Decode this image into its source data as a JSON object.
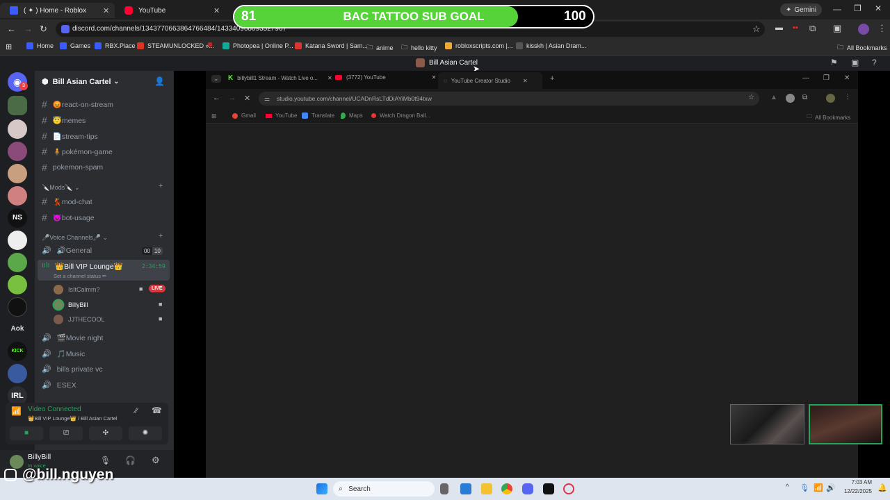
{
  "outer_browser": {
    "tabs": [
      {
        "label": "( ✦ ) Home - Roblox",
        "icon": "roblox-icon",
        "color": "#3a5cff"
      },
      {
        "label": "YouTube",
        "icon": "youtube-icon",
        "color": "#ff0033"
      }
    ],
    "gemini_label": "Gemini",
    "url": "discord.com/channels/1343770663864766484/143340968093527967",
    "bookmarks": [
      {
        "label": "Home",
        "icon": "roblox-icon",
        "color": "#3a5cff"
      },
      {
        "label": "Games",
        "icon": "roblox-icon",
        "color": "#3a5cff"
      },
      {
        "label": "RBX.Place",
        "icon": "rbx-icon",
        "color": "#3a5cff"
      },
      {
        "label": "STEAMUNLOCKED »...",
        "icon": "steam-icon",
        "color": "#d32"
      },
      {
        "label": "",
        "icon": "red-icon",
        "color": "#c22"
      },
      {
        "label": "Photopea | Online P...",
        "icon": "photopea-icon",
        "color": "#1a9"
      },
      {
        "label": "Katana Sword | Sam...",
        "icon": "katana-icon",
        "color": "#d33"
      },
      {
        "label": "anime",
        "icon": "folder-icon",
        "color": "#aaa"
      },
      {
        "label": "hello kitty",
        "icon": "folder-icon",
        "color": "#aaa"
      },
      {
        "label": "robloxscripts.com |...",
        "icon": "roblox-scripts-icon",
        "color": "#ea3"
      },
      {
        "label": "kisskh | Asian Dram...",
        "icon": "kisskh-icon",
        "color": "#555"
      }
    ],
    "all_bookmarks": "All Bookmarks"
  },
  "goal": {
    "start": "81",
    "title": "BAC TATTOO SUB GOAL",
    "end": "100",
    "fill_fraction": 0.79,
    "fill_color": "#57d33a"
  },
  "discord": {
    "title": "Bill Asian Cartel",
    "server_name": "Bill Asian Cartel",
    "channels": [
      {
        "name": "😡react-on-stream"
      },
      {
        "name": "😇memes"
      },
      {
        "name": "📄stream-tips"
      },
      {
        "name": "🧍pokémon-game"
      },
      {
        "name": "pokemon-spam"
      }
    ],
    "mods_category": "🔪Mods🔪",
    "mod_channels": [
      {
        "name": "💃mod-chat"
      },
      {
        "name": "😈bot-usage"
      }
    ],
    "voice_category": "🎤Voice Channels🎤",
    "voice_general": "🔊General",
    "voice_general_counts": [
      "00",
      "10"
    ],
    "vip_lounge": "👑Bill VIP Lounge👑",
    "vip_timer": "2:34:59",
    "channel_status": "Set a channel status ✏",
    "voice_users": [
      {
        "name": "IsItCalmm?",
        "live": "LIVE"
      },
      {
        "name": "BillyBill",
        "live": ""
      },
      {
        "name": "JJTHECOOL",
        "live": ""
      }
    ],
    "more_voice": [
      {
        "name": "🎬Movie night"
      },
      {
        "name": "🎵Music"
      },
      {
        "name": "bills private vc"
      },
      {
        "name": "ESEX"
      }
    ],
    "connection_status": "Video Connected",
    "connection_channel": "👑Bill VIP Lounge👑 / Bill Asian Cartel",
    "user_name": "BillyBill",
    "user_status": "In voice",
    "server_abbrs": [
      "NS",
      "Aok",
      "IRL"
    ]
  },
  "inner_browser": {
    "tabs": [
      {
        "label": "billybill1 Stream - Watch Live o...",
        "icon": "kick-icon",
        "color": "#53fc18"
      },
      {
        "label": "(3772) YouTube",
        "icon": "youtube-icon",
        "color": "#ff0033"
      },
      {
        "label": "YouTube Creator Studio",
        "icon": "loading-icon",
        "color": "#888"
      }
    ],
    "url": "studio.youtube.com/channel/UCADnRsLTdDiAYiMb0t94txw",
    "bookmarks": [
      {
        "label": "Gmail",
        "icon": "gmail-icon",
        "color": "#ea4335"
      },
      {
        "label": "YouTube",
        "icon": "youtube-icon",
        "color": "#ff0033"
      },
      {
        "label": "Translate",
        "icon": "translate-icon",
        "color": "#4285f4"
      },
      {
        "label": "Maps",
        "icon": "maps-icon",
        "color": "#34a853"
      },
      {
        "label": "Watch Dragon Ball...",
        "icon": "dragonball-icon",
        "color": "#e33"
      }
    ],
    "all_bookmarks": "All Bookmarks"
  },
  "watermark": "@bill.nguyen",
  "taskbar": {
    "search_placeholder": "Search",
    "time": "7:03 AM",
    "date": "12/22/2025"
  }
}
